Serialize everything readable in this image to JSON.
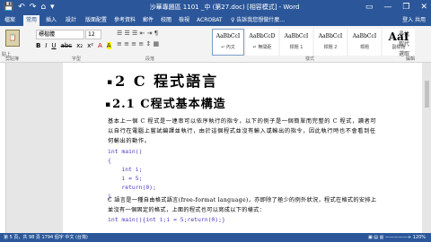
{
  "window": {
    "title": "沙華專題區 1101 _中 (第27.doc) [相容模式] - Word",
    "controls": [
      "▭",
      "—",
      "❐",
      "✕"
    ]
  },
  "qat": [
    "💾",
    "↶",
    "↷",
    "⌂",
    "▾"
  ],
  "tabs": [
    "檔案",
    "常用",
    "插入",
    "設計",
    "版面配置",
    "參考資料",
    "郵件",
    "校閱",
    "檢視",
    "ACROBAT"
  ],
  "tab_search": "♀ 告訴我您想做什麼...",
  "tab_right": "登入  共用",
  "ribbon": {
    "paste_label": "貼上",
    "clipboard_label": "剪貼簿",
    "font_name": "標楷體",
    "font_size": "12",
    "format_buttons": [
      "B",
      "I",
      "U",
      "abc",
      "x₂",
      "x²",
      "A",
      "A"
    ],
    "font_label": "字型",
    "para_row1": "☰ ☰ ☰ ⇤ ⇥ ¶",
    "para_row2": "≡ ≡ ≡ ≡ ↕ ▦",
    "para_label": "段落",
    "styles": [
      {
        "sample": "AaBbCcI",
        "name": "↵ 內文"
      },
      {
        "sample": "AaBbCcD",
        "name": "↵ 無間距"
      },
      {
        "sample": "AaBbCcI",
        "name": "標題 1"
      },
      {
        "sample": "AaBbCcI",
        "name": "標題 2"
      },
      {
        "sample": "AaBbCcI",
        "name": "標題"
      },
      {
        "sample": "AaI",
        "name": "副標題"
      }
    ],
    "styles_label": "樣式",
    "edit_items": [
      "尋找",
      "取代",
      "選取"
    ],
    "edit_label": "編輯"
  },
  "document": {
    "heading1": "2 C 程式語言",
    "heading2": "2.1  C程式基本構造",
    "paragraph1": "基本上一個 C 程式是一連串可以依序執行的指令，以下的例子是一個簡單而完整的 C 程式，讀者可以自行在電腦上嘗試編譯並執行，由於這個程式並沒有輸入或輸出的指令，因此執行時也不會看到任何輸出的動作。",
    "code1": "int main()\n{\n    int i;\n    i = 5;\n    return(0);\n}",
    "paragraph2": "C 語言是一種自由格式語言(free-format language)，亦即除了極少的例外狀況，程式在格式的安排上並沒有一個固定的格式，上面的程式也可以寫成以下的樣式：",
    "code2": "int main(){int i;i = 5;return(0);}"
  },
  "status": {
    "left": "第 5 頁，共 98 頁     1794 個字     中文 (台灣)",
    "right": "▣  ▤  ▥   —————+   120%"
  }
}
